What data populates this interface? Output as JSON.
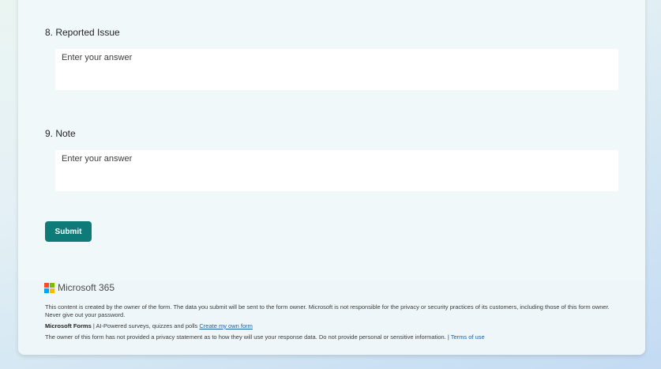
{
  "questions": [
    {
      "label": "8. Reported Issue",
      "placeholder": "Enter your answer"
    },
    {
      "label": "9. Note",
      "placeholder": "Enter your answer"
    }
  ],
  "submit_label": "Submit",
  "footer": {
    "brand": "Microsoft 365",
    "disclaimer": "This content is created by the owner of the form. The data you submit will be sent to the form owner. Microsoft is not responsible for the privacy or security practices of its customers, including those of this form owner. Never give out your password.",
    "forms_name": "Microsoft Forms",
    "forms_tagline": " | AI-Powered surveys, quizzes and polls ",
    "create_link": "Create my own form",
    "privacy_text": "The owner of this form has not provided a privacy statement as to how they will use your response data. Do not provide personal or sensitive information. | ",
    "terms_link": "Terms of use"
  },
  "colors": {
    "submit_button": "#0f7b78",
    "link": "#1a5fa6"
  },
  "icons": [
    "microsoft-logo-icon"
  ]
}
